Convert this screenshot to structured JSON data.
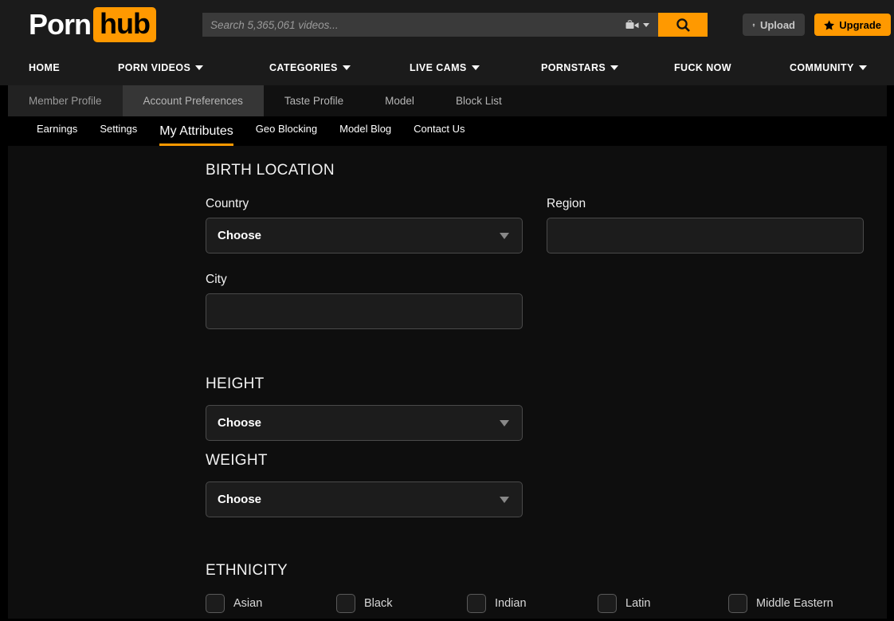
{
  "brand": {
    "name_part1": "Porn",
    "name_part2": "hub",
    "accent_color": "#ff9900"
  },
  "header": {
    "search": {
      "placeholder": "Search 5,365,061 videos...",
      "value": "",
      "type_icon": "video-camera-icon",
      "type_caret_icon": "chevron-down-icon",
      "submit_icon": "search-icon"
    },
    "upload_label": "Upload",
    "upload_icon": "upload-arrow-icon",
    "upgrade_label": "Upgrade",
    "upgrade_icon": "star-icon"
  },
  "mainnav": {
    "items": [
      {
        "label": "HOME",
        "has_caret": false
      },
      {
        "label": "PORN VIDEOS",
        "has_caret": true
      },
      {
        "label": "CATEGORIES",
        "has_caret": true
      },
      {
        "label": "LIVE CAMS",
        "has_caret": true
      },
      {
        "label": "PORNSTARS",
        "has_caret": true
      },
      {
        "label": "FUCK NOW",
        "has_caret": false
      },
      {
        "label": "COMMUNITY",
        "has_caret": true
      }
    ]
  },
  "tabs": [
    {
      "label": "Member Profile",
      "active": false,
      "plain": false
    },
    {
      "label": "Account Preferences",
      "active": true,
      "plain": false
    },
    {
      "label": "Taste Profile",
      "active": false,
      "plain": true
    },
    {
      "label": "Model",
      "active": false,
      "plain": true
    },
    {
      "label": "Block List",
      "active": false,
      "plain": true
    }
  ],
  "subnav": [
    {
      "label": "Earnings",
      "active": false
    },
    {
      "label": "Settings",
      "active": false
    },
    {
      "label": "My Attributes",
      "active": true
    },
    {
      "label": "Geo Blocking",
      "active": false
    },
    {
      "label": "Model Blog",
      "active": false
    },
    {
      "label": "Contact Us",
      "active": false
    }
  ],
  "form": {
    "birth_location": {
      "title": "BIRTH LOCATION",
      "country": {
        "label": "Country",
        "value": "Choose"
      },
      "region": {
        "label": "Region",
        "value": "",
        "placeholder": ""
      },
      "city": {
        "label": "City",
        "value": "",
        "placeholder": ""
      }
    },
    "height": {
      "title": "HEIGHT",
      "value": "Choose"
    },
    "weight": {
      "title": "WEIGHT",
      "value": "Choose"
    },
    "ethnicity": {
      "title": "ETHNICITY",
      "options": [
        {
          "label": "Asian",
          "checked": false
        },
        {
          "label": "Black",
          "checked": false
        },
        {
          "label": "Indian",
          "checked": false
        },
        {
          "label": "Latin",
          "checked": false
        },
        {
          "label": "Middle Eastern",
          "checked": false
        }
      ]
    }
  }
}
